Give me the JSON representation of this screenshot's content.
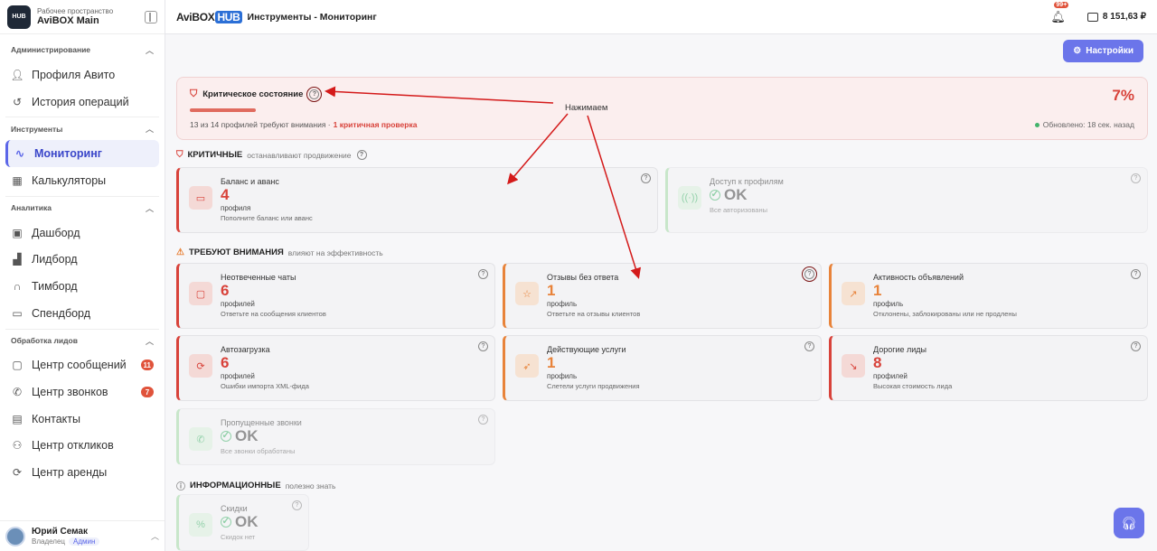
{
  "workspace": {
    "subtitle": "Рабочее пространство",
    "name": "AviBOX Main",
    "logo": "HUB"
  },
  "sidebar": {
    "sections": [
      {
        "title": "Администрирование",
        "items": [
          {
            "label": "Профиля Авито",
            "icon": "person-icon"
          },
          {
            "label": "История операций",
            "icon": "history-icon"
          }
        ]
      },
      {
        "title": "Инструменты",
        "items": [
          {
            "label": "Мониторинг",
            "icon": "pulse-icon",
            "active": true
          },
          {
            "label": "Калькуляторы",
            "icon": "calculator-icon"
          }
        ]
      },
      {
        "title": "Аналитика",
        "items": [
          {
            "label": "Дашборд",
            "icon": "dashboard-icon"
          },
          {
            "label": "Лидборд",
            "icon": "chart-icon"
          },
          {
            "label": "Тимборд",
            "icon": "headset-icon"
          },
          {
            "label": "Спендборд",
            "icon": "wallet-icon"
          }
        ]
      },
      {
        "title": "Обработка лидов",
        "items": [
          {
            "label": "Центр сообщений",
            "icon": "chat-icon",
            "badge": "11"
          },
          {
            "label": "Центр звонков",
            "icon": "phone-icon",
            "badge": "7"
          },
          {
            "label": "Контакты",
            "icon": "contacts-icon"
          },
          {
            "label": "Центр откликов",
            "icon": "user-plus-icon"
          },
          {
            "label": "Центр аренды",
            "icon": "refresh-icon"
          }
        ]
      }
    ]
  },
  "user": {
    "name": "Юрий Семак",
    "role": "Владелец",
    "badge": "Админ"
  },
  "topbar": {
    "brand": "AviBOX",
    "brand_hub": "HUB",
    "title": "Инструменты - Мониторинг",
    "notifications": "99+",
    "balance": "8 151,63 ₽"
  },
  "settings_button": "Настройки",
  "critical": {
    "title": "Критическое состояние",
    "percent": "7%",
    "progress": 0.07,
    "summary": "13 из 14 профилей требуют внимания ·",
    "alert": "1 критичная проверка",
    "updated": "Обновлено: 18 сек. назад"
  },
  "annotation": "Нажимаем",
  "groups": {
    "critical": {
      "title": "КРИТИЧНЫЕ",
      "subtitle": "останавливают продвижение"
    },
    "attention": {
      "title": "ТРЕБУЮТ ВНИМАНИЯ",
      "subtitle": "влияют на эффективность"
    },
    "info": {
      "title": "ИНФОРМАЦИОННЫЕ",
      "subtitle": "полезно знать"
    }
  },
  "cards": {
    "balance": {
      "title": "Баланс и аванс",
      "value": "4",
      "unit": "профиля",
      "desc": "Пополните баланс или аванс"
    },
    "access": {
      "title": "Доступ к профилям",
      "value": "OK",
      "desc": "Все авторизованы"
    },
    "chats": {
      "title": "Неотвеченные чаты",
      "value": "6",
      "unit": "профилей",
      "desc": "Ответьте на сообщения клиентов"
    },
    "reviews": {
      "title": "Отзывы без ответа",
      "value": "1",
      "unit": "профиль",
      "desc": "Ответьте на отзывы клиентов"
    },
    "activity": {
      "title": "Активность объявлений",
      "value": "1",
      "unit": "профиль",
      "desc": "Отклонены, заблокированы или не продлены"
    },
    "autoload": {
      "title": "Автозагрузка",
      "value": "6",
      "unit": "профилей",
      "desc": "Ошибки импорта XML-фида"
    },
    "services": {
      "title": "Действующие услуги",
      "value": "1",
      "unit": "профиль",
      "desc": "Слетели услуги продвижения"
    },
    "leads": {
      "title": "Дорогие лиды",
      "value": "8",
      "unit": "профилей",
      "desc": "Высокая стоимость лида"
    },
    "calls": {
      "title": "Пропущенные звонки",
      "value": "OK",
      "desc": "Все звонки обработаны"
    },
    "discounts": {
      "title": "Скидки",
      "value": "OK",
      "desc": "Скидок нет"
    }
  }
}
